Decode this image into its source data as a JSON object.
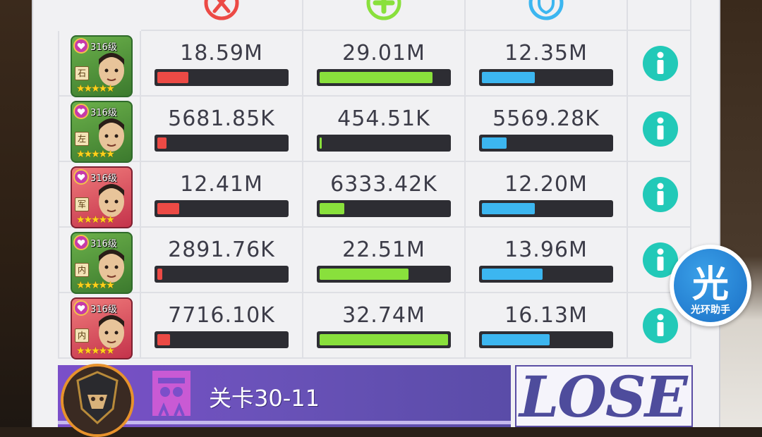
{
  "headers": {
    "damage_icon": "crossed-sword-icon",
    "heal_icon": "plus-icon",
    "tank_icon": "shield-icon"
  },
  "colors": {
    "damage": "#ec4a45",
    "heal": "#89e03c",
    "tank": "#3cb6f0",
    "info": "#22c9b8"
  },
  "rows": [
    {
      "level": "316级",
      "faction": "石",
      "stars": "★★★★★",
      "frame": "green",
      "damage": "18.59M",
      "damage_fill": 0.24,
      "heal": "29.01M",
      "heal_fill": 0.88,
      "tank": "12.35M",
      "tank_fill": 0.41
    },
    {
      "level": "316级",
      "faction": "左",
      "stars": "★★★★★",
      "frame": "green",
      "damage": "5681.85K",
      "damage_fill": 0.07,
      "heal": "454.51K",
      "heal_fill": 0.01,
      "tank": "5569.28K",
      "tank_fill": 0.19
    },
    {
      "level": "316级",
      "faction": "军",
      "stars": "★★★★★",
      "frame": "red",
      "damage": "12.41M",
      "damage_fill": 0.17,
      "heal": "6333.42K",
      "heal_fill": 0.19,
      "tank": "12.20M",
      "tank_fill": 0.41
    },
    {
      "level": "316级",
      "faction": "内",
      "stars": "★★★★★",
      "frame": "green",
      "damage": "2891.76K",
      "damage_fill": 0.04,
      "heal": "22.51M",
      "heal_fill": 0.69,
      "tank": "13.96M",
      "tank_fill": 0.47
    },
    {
      "level": "316级",
      "faction": "内",
      "stars": "★★★★★",
      "frame": "red",
      "damage": "7716.10K",
      "damage_fill": 0.1,
      "heal": "32.74M",
      "heal_fill": 1.0,
      "tank": "16.13M",
      "tank_fill": 0.53
    }
  ],
  "stage": {
    "label": "关卡30-11",
    "result": "LOSE"
  },
  "helper": {
    "glyph": "光",
    "label": "光环助手"
  }
}
